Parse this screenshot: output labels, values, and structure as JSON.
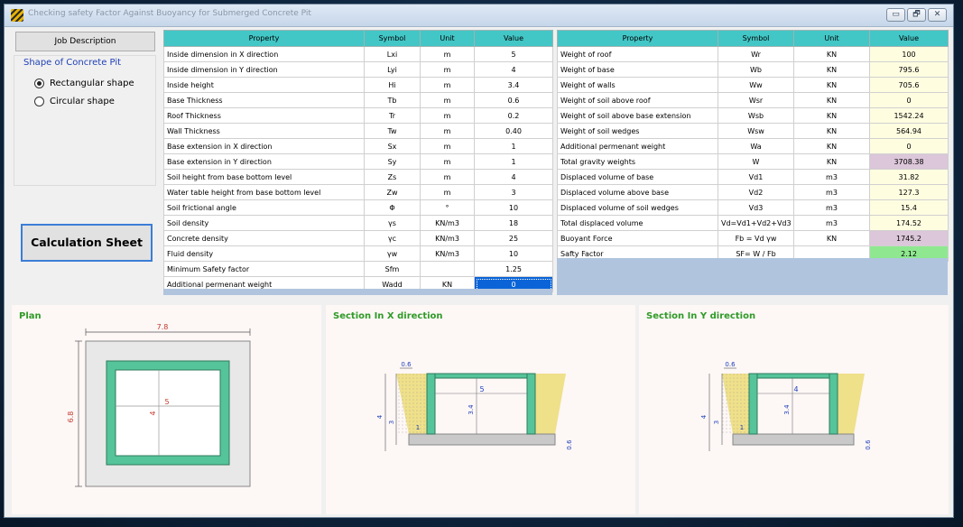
{
  "window": {
    "title": "Checking safety Factor Against Buoyancy for Submerged Concrete Pit",
    "controls": {
      "minimize": "▭",
      "maximize": "🗗",
      "close": "✕"
    }
  },
  "left_panel": {
    "job_button": "Job Description",
    "shape_group_title": "Shape of Concrete Pit",
    "shape_options": [
      {
        "label": "Rectangular shape",
        "selected": true
      },
      {
        "label": "Circular shape",
        "selected": false
      }
    ],
    "calc_button": "Calculation Sheet"
  },
  "input_table": {
    "headers": [
      "Property",
      "Symbol",
      "Unit",
      "Value"
    ],
    "rows": [
      {
        "property": "Inside dimension in X direction",
        "symbol": "Lxi",
        "unit": "m",
        "value": "5"
      },
      {
        "property": "Inside dimension in Y direction",
        "symbol": "Lyi",
        "unit": "m",
        "value": "4"
      },
      {
        "property": "Inside height",
        "symbol": "Hi",
        "unit": "m",
        "value": "3.4"
      },
      {
        "property": "Base Thickness",
        "symbol": "Tb",
        "unit": "m",
        "value": "0.6"
      },
      {
        "property": "Roof Thickness",
        "symbol": "Tr",
        "unit": "m",
        "value": "0.2"
      },
      {
        "property": "Wall Thickness",
        "symbol": "Tw",
        "unit": "m",
        "value": "0.40"
      },
      {
        "property": "Base extension in X direction",
        "symbol": "Sx",
        "unit": "m",
        "value": "1"
      },
      {
        "property": "Base extension in Y direction",
        "symbol": "Sy",
        "unit": "m",
        "value": "1"
      },
      {
        "property": "Soil height from base bottom level",
        "symbol": "Zs",
        "unit": "m",
        "value": "4"
      },
      {
        "property": "Water table height from base bottom level",
        "symbol": "Zw",
        "unit": "m",
        "value": "3"
      },
      {
        "property": "Soil frictional angle",
        "symbol": "Φ",
        "unit": "°",
        "value": "10"
      },
      {
        "property": "Soil density",
        "symbol": "γs",
        "unit": "KN/m3",
        "value": "18"
      },
      {
        "property": "Concrete density",
        "symbol": "γc",
        "unit": "KN/m3",
        "value": "25"
      },
      {
        "property": "Fluid density",
        "symbol": "γw",
        "unit": "KN/m3",
        "value": "10"
      },
      {
        "property": "Minimum Safety factor",
        "symbol": "Sfm",
        "unit": "",
        "value": "1.25"
      },
      {
        "property": "Additional permenant weight",
        "symbol": "Wadd",
        "unit": "KN",
        "value": "0"
      }
    ]
  },
  "result_table": {
    "headers": [
      "Property",
      "Symbol",
      "Unit",
      "Value"
    ],
    "rows": [
      {
        "property": "Weight of roof",
        "symbol": "Wr",
        "unit": "KN",
        "value": "100",
        "style": "cream"
      },
      {
        "property": "Weight of base",
        "symbol": "Wb",
        "unit": "KN",
        "value": "795.6",
        "style": "cream"
      },
      {
        "property": "Weight of walls",
        "symbol": "Ww",
        "unit": "KN",
        "value": "705.6",
        "style": "cream"
      },
      {
        "property": "Weight of soil above roof",
        "symbol": "Wsr",
        "unit": "KN",
        "value": "0",
        "style": "cream"
      },
      {
        "property": "Weight of soil above base extension",
        "symbol": "Wsb",
        "unit": "KN",
        "value": "1542.24",
        "style": "cream"
      },
      {
        "property": "Weight of soil wedges",
        "symbol": "Wsw",
        "unit": "KN",
        "value": "564.94",
        "style": "cream"
      },
      {
        "property": "Additional permenant weight",
        "symbol": "Wa",
        "unit": "KN",
        "value": "0",
        "style": "cream"
      },
      {
        "property": "Total gravity weights",
        "symbol": "W",
        "unit": "KN",
        "value": "3708.38",
        "style": "pink"
      },
      {
        "property": "Displaced volume of base",
        "symbol": "Vd1",
        "unit": "m3",
        "value": "31.82",
        "style": "cream"
      },
      {
        "property": "Displaced volume above base",
        "symbol": "Vd2",
        "unit": "m3",
        "value": "127.3",
        "style": "cream"
      },
      {
        "property": "Displaced volume of soil wedges",
        "symbol": "Vd3",
        "unit": "m3",
        "value": "15.4",
        "style": "cream"
      },
      {
        "property": "Total displaced volume",
        "symbol": "Vd=Vd1+Vd2+Vd3",
        "unit": "m3",
        "value": "174.52",
        "style": "cream"
      },
      {
        "property": "Buoyant Force",
        "symbol": "Fb = Vd γw",
        "unit": "KN",
        "value": "1745.2",
        "style": "pink"
      },
      {
        "property": "Safty Factor",
        "symbol": "SF= W / Fb",
        "unit": "",
        "value": "2.12",
        "style": "green"
      }
    ]
  },
  "plan": {
    "title": "Plan",
    "dims": {
      "outer_x": "7.8",
      "outer_y": "6.8",
      "inner_x": "5",
      "inner_y": "4"
    }
  },
  "section_x": {
    "title": "Section In X direction",
    "dims": {
      "slope": "0.6",
      "inside": "5",
      "height": "3.4",
      "soil": "4",
      "water": "3",
      "ext": "1",
      "base": "0.6"
    }
  },
  "section_y": {
    "title": "Section In Y direction",
    "dims": {
      "slope": "0.6",
      "inside": "4",
      "height": "3.4",
      "soil": "4",
      "water": "3",
      "ext": "1",
      "base": "0.6"
    }
  },
  "colors": {
    "header_teal": "#43c6c6",
    "cream": "#fffde0",
    "pink": "#dcc6d9",
    "green": "#8fe88f",
    "concrete_wall": "#55c49a",
    "soil": "#efe08a",
    "selected_blue": "#0a64d8"
  }
}
